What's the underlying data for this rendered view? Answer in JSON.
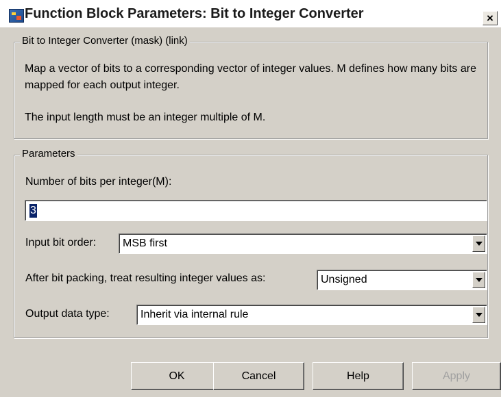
{
  "window": {
    "title": "Function Block Parameters: Bit to Integer Converter",
    "close_glyph": "×"
  },
  "description": {
    "legend": "Bit to Integer Converter (mask) (link)",
    "line1": "Map a vector of bits to a corresponding vector of integer values. M defines how many bits are mapped for each output integer.",
    "line2": "The input length must be an integer multiple of M."
  },
  "parameters": {
    "legend": "Parameters",
    "bits_label": "Number of bits per integer(M):",
    "bits_value": "3",
    "bit_order_label": "Input bit order:",
    "bit_order_value": "MSB first",
    "treat_label": "After bit packing, treat resulting integer values as:",
    "treat_value": "Unsigned",
    "dtype_label": "Output data type:",
    "dtype_value": "Inherit via internal rule"
  },
  "buttons": {
    "ok": "OK",
    "cancel": "Cancel",
    "help": "Help",
    "apply": "Apply"
  },
  "icons": {
    "window_icon": "simulink-block-icon",
    "close_icon": "close-icon",
    "dropdown_icon": "chevron-down-icon"
  }
}
